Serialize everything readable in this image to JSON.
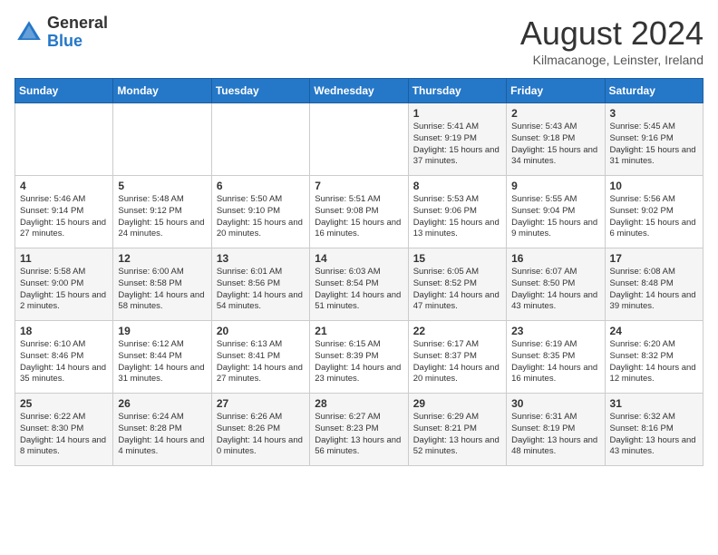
{
  "logo": {
    "general": "General",
    "blue": "Blue"
  },
  "title": "August 2024",
  "subtitle": "Kilmacanoge, Leinster, Ireland",
  "days_of_week": [
    "Sunday",
    "Monday",
    "Tuesday",
    "Wednesday",
    "Thursday",
    "Friday",
    "Saturday"
  ],
  "weeks": [
    [
      {
        "day": "",
        "info": ""
      },
      {
        "day": "",
        "info": ""
      },
      {
        "day": "",
        "info": ""
      },
      {
        "day": "",
        "info": ""
      },
      {
        "day": "1",
        "info": "Sunrise: 5:41 AM\nSunset: 9:19 PM\nDaylight: 15 hours and 37 minutes."
      },
      {
        "day": "2",
        "info": "Sunrise: 5:43 AM\nSunset: 9:18 PM\nDaylight: 15 hours and 34 minutes."
      },
      {
        "day": "3",
        "info": "Sunrise: 5:45 AM\nSunset: 9:16 PM\nDaylight: 15 hours and 31 minutes."
      }
    ],
    [
      {
        "day": "4",
        "info": "Sunrise: 5:46 AM\nSunset: 9:14 PM\nDaylight: 15 hours and 27 minutes."
      },
      {
        "day": "5",
        "info": "Sunrise: 5:48 AM\nSunset: 9:12 PM\nDaylight: 15 hours and 24 minutes."
      },
      {
        "day": "6",
        "info": "Sunrise: 5:50 AM\nSunset: 9:10 PM\nDaylight: 15 hours and 20 minutes."
      },
      {
        "day": "7",
        "info": "Sunrise: 5:51 AM\nSunset: 9:08 PM\nDaylight: 15 hours and 16 minutes."
      },
      {
        "day": "8",
        "info": "Sunrise: 5:53 AM\nSunset: 9:06 PM\nDaylight: 15 hours and 13 minutes."
      },
      {
        "day": "9",
        "info": "Sunrise: 5:55 AM\nSunset: 9:04 PM\nDaylight: 15 hours and 9 minutes."
      },
      {
        "day": "10",
        "info": "Sunrise: 5:56 AM\nSunset: 9:02 PM\nDaylight: 15 hours and 6 minutes."
      }
    ],
    [
      {
        "day": "11",
        "info": "Sunrise: 5:58 AM\nSunset: 9:00 PM\nDaylight: 15 hours and 2 minutes."
      },
      {
        "day": "12",
        "info": "Sunrise: 6:00 AM\nSunset: 8:58 PM\nDaylight: 14 hours and 58 minutes."
      },
      {
        "day": "13",
        "info": "Sunrise: 6:01 AM\nSunset: 8:56 PM\nDaylight: 14 hours and 54 minutes."
      },
      {
        "day": "14",
        "info": "Sunrise: 6:03 AM\nSunset: 8:54 PM\nDaylight: 14 hours and 51 minutes."
      },
      {
        "day": "15",
        "info": "Sunrise: 6:05 AM\nSunset: 8:52 PM\nDaylight: 14 hours and 47 minutes."
      },
      {
        "day": "16",
        "info": "Sunrise: 6:07 AM\nSunset: 8:50 PM\nDaylight: 14 hours and 43 minutes."
      },
      {
        "day": "17",
        "info": "Sunrise: 6:08 AM\nSunset: 8:48 PM\nDaylight: 14 hours and 39 minutes."
      }
    ],
    [
      {
        "day": "18",
        "info": "Sunrise: 6:10 AM\nSunset: 8:46 PM\nDaylight: 14 hours and 35 minutes."
      },
      {
        "day": "19",
        "info": "Sunrise: 6:12 AM\nSunset: 8:44 PM\nDaylight: 14 hours and 31 minutes."
      },
      {
        "day": "20",
        "info": "Sunrise: 6:13 AM\nSunset: 8:41 PM\nDaylight: 14 hours and 27 minutes."
      },
      {
        "day": "21",
        "info": "Sunrise: 6:15 AM\nSunset: 8:39 PM\nDaylight: 14 hours and 23 minutes."
      },
      {
        "day": "22",
        "info": "Sunrise: 6:17 AM\nSunset: 8:37 PM\nDaylight: 14 hours and 20 minutes."
      },
      {
        "day": "23",
        "info": "Sunrise: 6:19 AM\nSunset: 8:35 PM\nDaylight: 14 hours and 16 minutes."
      },
      {
        "day": "24",
        "info": "Sunrise: 6:20 AM\nSunset: 8:32 PM\nDaylight: 14 hours and 12 minutes."
      }
    ],
    [
      {
        "day": "25",
        "info": "Sunrise: 6:22 AM\nSunset: 8:30 PM\nDaylight: 14 hours and 8 minutes."
      },
      {
        "day": "26",
        "info": "Sunrise: 6:24 AM\nSunset: 8:28 PM\nDaylight: 14 hours and 4 minutes."
      },
      {
        "day": "27",
        "info": "Sunrise: 6:26 AM\nSunset: 8:26 PM\nDaylight: 14 hours and 0 minutes."
      },
      {
        "day": "28",
        "info": "Sunrise: 6:27 AM\nSunset: 8:23 PM\nDaylight: 13 hours and 56 minutes."
      },
      {
        "day": "29",
        "info": "Sunrise: 6:29 AM\nSunset: 8:21 PM\nDaylight: 13 hours and 52 minutes."
      },
      {
        "day": "30",
        "info": "Sunrise: 6:31 AM\nSunset: 8:19 PM\nDaylight: 13 hours and 48 minutes."
      },
      {
        "day": "31",
        "info": "Sunrise: 6:32 AM\nSunset: 8:16 PM\nDaylight: 13 hours and 43 minutes."
      }
    ]
  ]
}
